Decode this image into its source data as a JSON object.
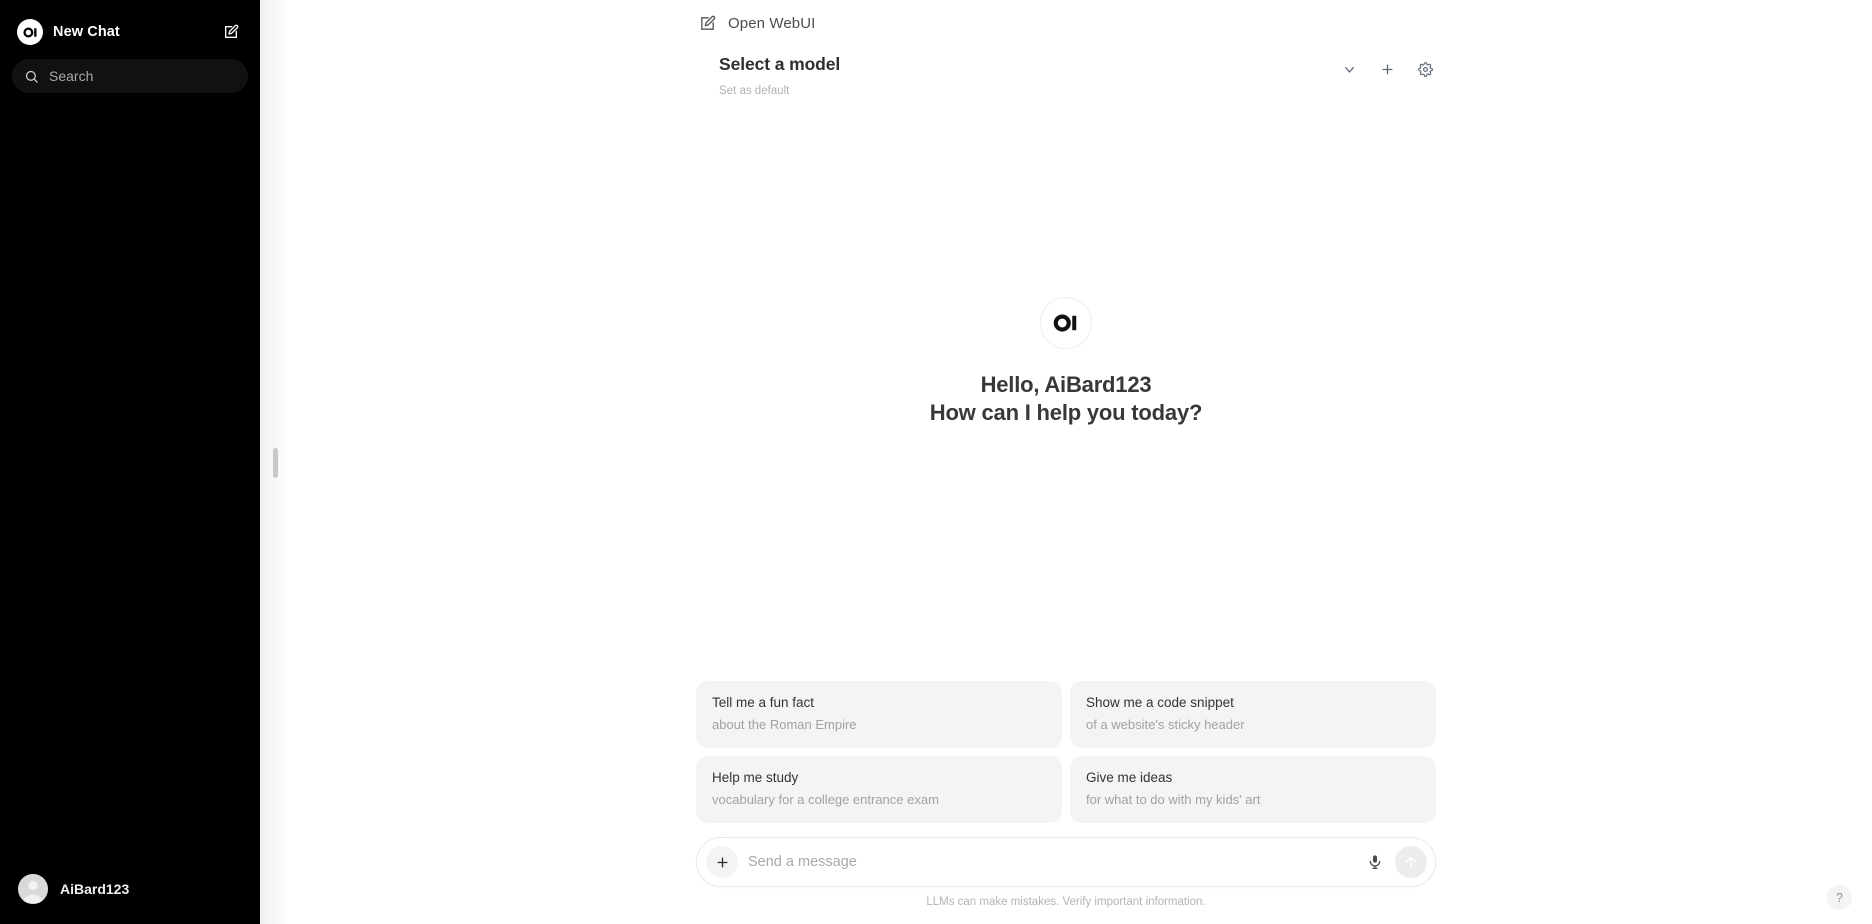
{
  "sidebar": {
    "logo_icon": "open-webui-logo-icon",
    "new_chat_label": "New Chat",
    "new_chat_icon": "pencil-square-icon",
    "search": {
      "placeholder": "Search",
      "value": "",
      "icon": "search-icon"
    },
    "user": {
      "name": "AiBard123",
      "avatar_icon": "user-avatar-icon"
    },
    "background_color": "#000000"
  },
  "topbar": {
    "new_chat_icon": "pencil-square-icon",
    "title": "Open WebUI"
  },
  "model_bar": {
    "selected_model": "Select a model",
    "set_default_label": "Set as default",
    "actions": [
      {
        "name": "chevron-down-icon",
        "label": ""
      },
      {
        "name": "plus-icon",
        "label": ""
      },
      {
        "name": "gear-icon",
        "label": ""
      }
    ]
  },
  "hero": {
    "logo_icon": "open-webui-logo-icon",
    "greeting": "Hello, AiBard123",
    "question": "How can I help you today?"
  },
  "suggestions": [
    {
      "title": "Tell me a fun fact",
      "subtitle": "about the Roman Empire"
    },
    {
      "title": "Show me a code snippet",
      "subtitle": "of a website's sticky header"
    },
    {
      "title": "Help me study",
      "subtitle": "vocabulary for a college entrance exam"
    },
    {
      "title": "Give me ideas",
      "subtitle": "for what to do with my kids' art"
    }
  ],
  "composer": {
    "add_icon": "plus-icon",
    "placeholder": "Send a message",
    "value": "",
    "mic_icon": "microphone-icon",
    "send_icon": "arrow-up-icon"
  },
  "footer": {
    "disclaimer": "LLMs can make mistakes. Verify important information."
  },
  "help": {
    "label": "?"
  },
  "colors": {
    "sidebar_bg": "#000000",
    "card_bg": "#f4f4f4",
    "text_primary": "#333333",
    "text_muted": "#a2a2a2",
    "page_bg": "#ffffff"
  }
}
